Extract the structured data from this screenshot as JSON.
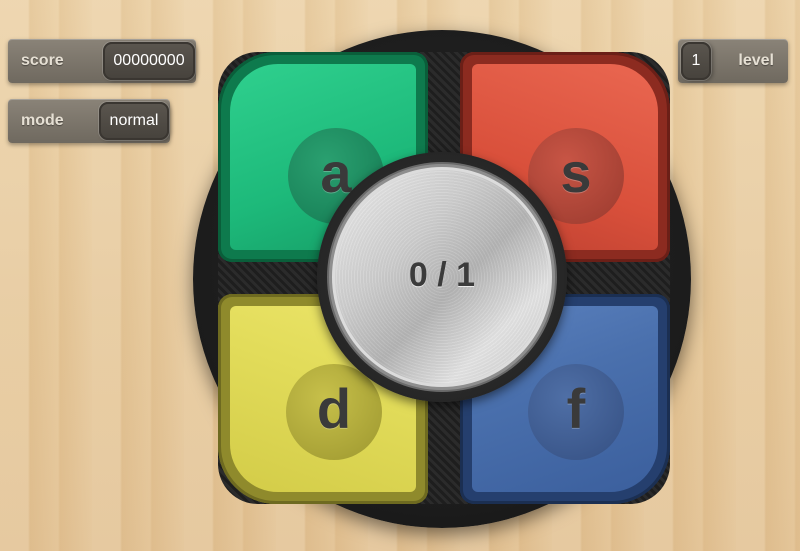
{
  "hud": {
    "score": {
      "label": "score",
      "value": "00000000"
    },
    "mode": {
      "label": "mode",
      "value": "normal"
    },
    "level": {
      "label": "level",
      "value": "1"
    }
  },
  "pads": {
    "green": {
      "key": "a",
      "color": "#1db97a"
    },
    "red": {
      "key": "s",
      "color": "#d9503b"
    },
    "yellow": {
      "key": "d",
      "color": "#e2dc5a"
    },
    "blue": {
      "key": "f",
      "color": "#4a70ad"
    }
  },
  "center": {
    "progress": "0 / 1"
  }
}
